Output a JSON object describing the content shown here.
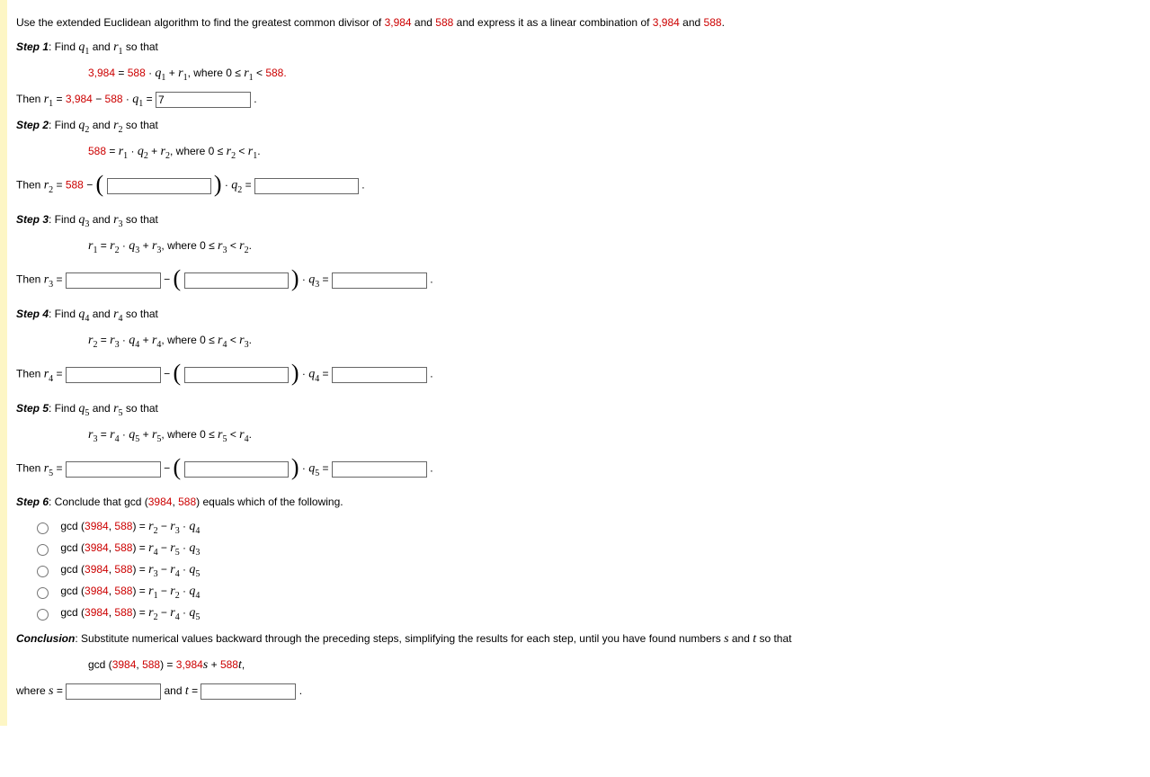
{
  "intro": {
    "t1": "Use the extended Euclidean algorithm to find the greatest common divisor of ",
    "n1": "3,984",
    "t2": " and ",
    "n2": "588",
    "t3": " and express it as a linear combination of ",
    "n3": "3,984",
    "t4": " and ",
    "n4": "588",
    "t5": "."
  },
  "step1": {
    "label": "Step 1",
    "lead": ": Find ",
    "trail": " so that",
    "eq_n1": "3,984",
    "eq_eqs": " = ",
    "eq_n2": "588",
    "eq_dot": " · ",
    "eq_plus": " + ",
    "eq_where": ",   where  0 ≤ ",
    "eq_lt": " < ",
    "eq_end": "588.",
    "then": "Then ",
    "then_eq": " = ",
    "then_n1": "3,984",
    "then_minus": " − ",
    "then_n2": "588",
    "then_dot": " · ",
    "then_eq2": " = ",
    "val": "7",
    "period": " ."
  },
  "step2": {
    "label": "Step 2",
    "lead": ": Find ",
    "trail": " so that",
    "eq_n1": "588",
    "eq_eqs": " = ",
    "eq_dot": " · ",
    "eq_plus": " + ",
    "eq_where": ",   where  0 ≤ ",
    "eq_lt": " < ",
    "eq_end": ".",
    "then": "Then ",
    "then_eq": " = ",
    "then_n1": "588",
    "then_minus": " − ",
    "then_dot": " · ",
    "then_eq2": " = ",
    "period": " ."
  },
  "step3": {
    "label": "Step 3",
    "lead": ": Find ",
    "trail": " so that",
    "eq_eqs": " = ",
    "eq_dot": " · ",
    "eq_plus": " + ",
    "eq_where": ",   where  0 ≤ ",
    "eq_lt": " < ",
    "eq_end": ".",
    "then": "Then ",
    "then_eq": " = ",
    "then_minus": " − ",
    "then_dot": " · ",
    "then_eq2": " = ",
    "period": " ."
  },
  "step4": {
    "label": "Step 4",
    "lead": ": Find ",
    "trail": " so that",
    "eq_eqs": " = ",
    "eq_dot": " · ",
    "eq_plus": " + ",
    "eq_where": ",   where  0 ≤ ",
    "eq_lt": " < ",
    "eq_end": ".",
    "then": "Then ",
    "then_eq": " = ",
    "then_minus": " − ",
    "then_dot": " · ",
    "then_eq2": " = ",
    "period": " ."
  },
  "step5": {
    "label": "Step 5",
    "lead": ": Find ",
    "trail": " so that",
    "eq_eqs": " = ",
    "eq_dot": " · ",
    "eq_plus": " + ",
    "eq_where": ",   where  0 ≤ ",
    "eq_lt": " < ",
    "eq_end": ".",
    "then": "Then ",
    "then_eq": " = ",
    "then_minus": " − ",
    "then_dot": " · ",
    "then_eq2": " = ",
    "period": " ."
  },
  "step6": {
    "label": "Step 6",
    "lead": ": Conclude that gcd (",
    "n1": "3984",
    "comma": ", ",
    "n2": "588",
    "trail": ") equals which of the following.",
    "opt_prefix": "gcd (",
    "opt_n1": "3984",
    "opt_comma": ", ",
    "opt_n2": "588",
    "opt_close": ") = ",
    "minus": " − ",
    "dot": " · "
  },
  "conclusion": {
    "label": "Conclusion",
    "text": ": Substitute numerical values backward through the preceding steps, simplifying the results for each step, until you have found numbers ",
    "and": " and ",
    "trail": " so that",
    "eq_pre": "gcd (",
    "eq_n1": "3984",
    "eq_comma": ", ",
    "eq_n2": "588",
    "eq_close": ") = ",
    "eq_a": "3,984",
    "eq_plus": " + ",
    "eq_b": "588",
    "eq_end": ",",
    "where": "where ",
    "eq": " = ",
    "period": " ."
  },
  "and_word": " and "
}
